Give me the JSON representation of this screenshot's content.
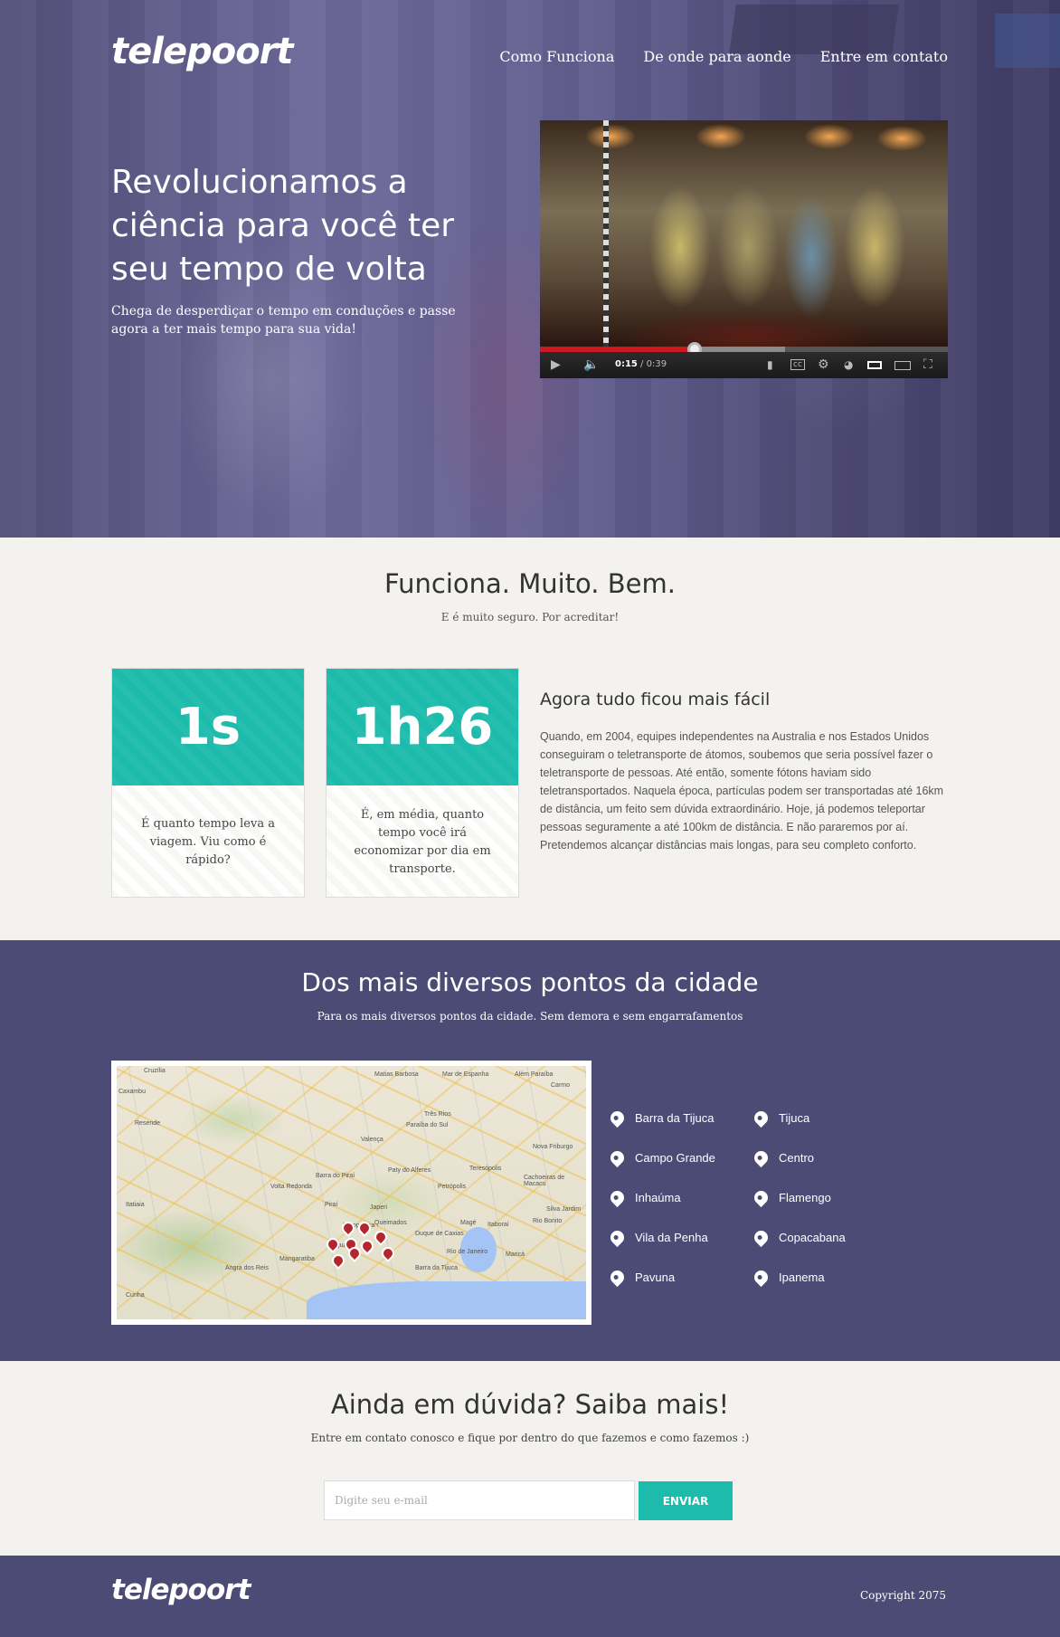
{
  "header": {
    "logo": "telepoort",
    "nav": [
      "Como Funciona",
      "De onde para aonde",
      "Entre em contato"
    ]
  },
  "hero": {
    "title": "Revolucionamos a ciência para você ter seu tempo de volta",
    "subtitle": "Chega de desperdiçar o tempo em conduções e passe agora a ter mais tempo para sua vida!"
  },
  "video": {
    "current_time": "0:15",
    "duration": " / 0:39",
    "progress": 0.38,
    "buffered": 0.6
  },
  "funciona": {
    "title": "Funciona. Muito. Bem.",
    "subtitle": "E é muito seguro. Por acreditar!",
    "cards": [
      {
        "value": "1s",
        "text": "É quanto tempo leva a viagem. Viu como é rápido?"
      },
      {
        "value": "1h26",
        "text": "É, em média, quanto tempo você irá economizar por dia em transporte."
      }
    ],
    "info_title": "Agora tudo ficou mais fácil",
    "info_text": "Quando, em 2004, equipes independentes na Australia e nos Estados Unidos conseguiram o teletransporte de átomos, soubemos que seria possível fazer o teletransporte de pessoas. Até então, somente fótons haviam sido teletransportados. Naquela época, partículas podem ser transportadas até 16km de distância, um feito sem dúvida extraordinário. Hoje, já podemos teleportar pessoas seguramente a até 100km de distância. E não pararemos por aí. Pretendemos alcançar distâncias mais longas, para seu completo conforto."
  },
  "pontos": {
    "title": "Dos mais diversos pontos da cidade",
    "subtitle": "Para os mais diversos pontos da cidade. Sem demora e sem engarrafamentos",
    "places_col1": [
      "Barra da Tijuca",
      "Campo Grande",
      "Inhaúma",
      "Vila da Penha",
      "Pavuna"
    ],
    "places_col2": [
      "Tijuca",
      "Centro",
      "Flamengo",
      "Copacabana",
      "Ipanema"
    ],
    "map_labels": [
      "Cruzília",
      "Caxambu",
      "Matias Barbosa",
      "Mar de Espanha",
      "Além Paraíba",
      "Carmo",
      "Três Rios",
      "Paraíba do Sul",
      "Valença",
      "Nova Friburgo",
      "Teresópolis",
      "Petrópolis",
      "Volta Redonda",
      "Barra do Piraí",
      "Paty do Alferes",
      "Cachoeiras de Macacu",
      "Piraí",
      "Japeri",
      "Queimados",
      "Seropédica",
      "Duque de Caxias",
      "Magé",
      "Itaboraí",
      "Rio Bonito",
      "Rio de Janeiro",
      "Maricá",
      "Mangaratiba",
      "Angra dos Reis",
      "Barra da Tijuca",
      "Itaguaí",
      "Silva Jardim",
      "Resende",
      "Itatiaia",
      "Cunha"
    ]
  },
  "duvida": {
    "title": "Ainda em dúvida? Saiba mais!",
    "subtitle": "Entre em contato conosco e fique por dentro do que fazemos e como fazemos :)",
    "email_placeholder": "Digite seu e-mail",
    "send_label": "ENVIAR"
  },
  "footer": {
    "logo": "telepoort",
    "copyright": "Copyright 2075"
  },
  "colors": {
    "accent": "#1dbbab",
    "purple": "#4c4b76",
    "background": "#f3f2ee",
    "pin": "#b3262d"
  },
  "icons": [
    "play-icon",
    "volume-icon",
    "captions-icon",
    "cc-icon",
    "settings-icon",
    "watch-later-icon",
    "small-player-icon",
    "large-player-icon",
    "fullscreen-icon",
    "map-pin-icon"
  ]
}
